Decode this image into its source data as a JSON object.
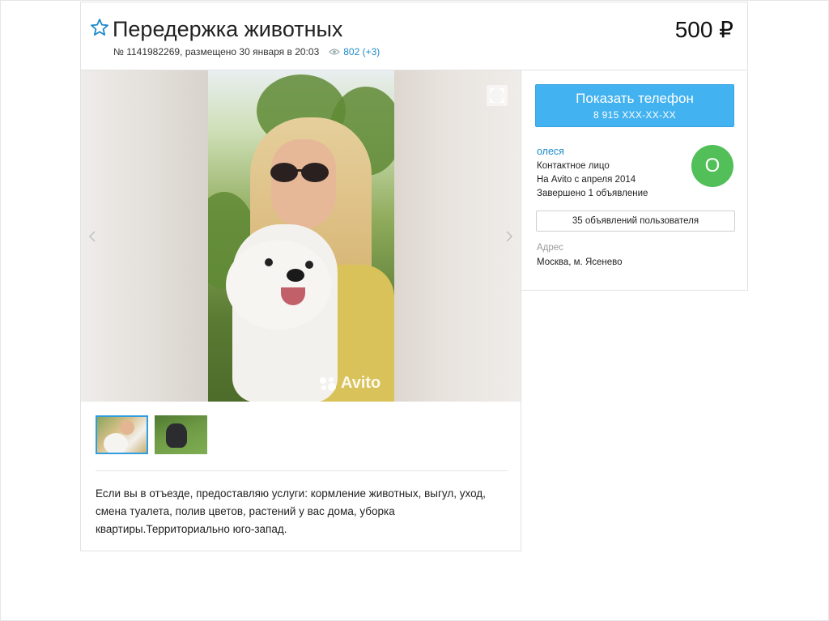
{
  "header": {
    "title": "Передержка животных",
    "ad_info": "№ 1141982269, размещено 30 января в 20:03",
    "views": "802 (+3)",
    "price": "500 ₽"
  },
  "gallery": {
    "watermark": "Avito",
    "thumbnails": [
      {
        "icon": "photo-woman-with-dog",
        "selected": true
      },
      {
        "icon": "photo-cat-on-grass",
        "selected": false
      }
    ]
  },
  "description": "Если вы в отъезде, предоставляю услуги: кормление животных, выгул, уход, смена туалета, полив цветов, растений у вас дома, уборка квартиры.Территориально юго-запад.",
  "sidebar": {
    "phone_button_label": "Показать телефон",
    "phone_number": "8 915 XXX-XX-XX",
    "seller_name": "олеся",
    "seller_role": "Контактное лицо",
    "seller_since": "На Avito с апреля 2014",
    "seller_completed": "Завершено 1 объявление",
    "avatar_letter": "О",
    "ads_button_label": "35 объявлений пользователя",
    "address_label": "Адрес",
    "address_value": "Москва, м. Ясенево"
  },
  "colors": {
    "accent": "#43b2f0",
    "link": "#1d8ac9",
    "avatar": "#53bf58",
    "thumb_selected": "#2f9de0"
  }
}
